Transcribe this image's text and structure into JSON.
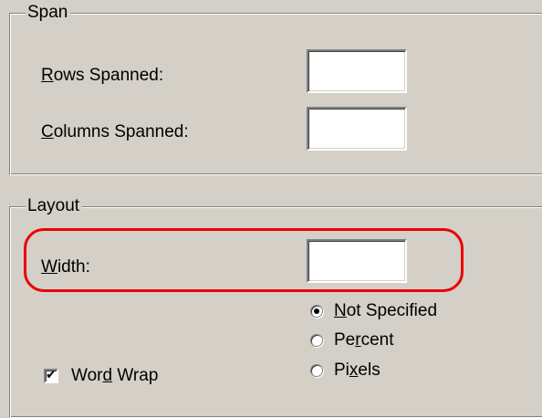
{
  "span": {
    "title": "Span",
    "rows_label_mnemonic": "R",
    "rows_label_rest": "ows Spanned:",
    "rows_value": "",
    "cols_label_mnemonic": "C",
    "cols_label_rest": "olumns Spanned:",
    "cols_value": ""
  },
  "layout": {
    "title": "Layout",
    "width_label_mnemonic": "W",
    "width_label_rest": "idth:",
    "width_value": "",
    "width_units": {
      "not_specified_mnemonic": "N",
      "not_specified_rest": "ot Specified",
      "not_specified_checked": true,
      "percent_pre": "Pe",
      "percent_mnemonic": "r",
      "percent_post": "cent",
      "pixels_pre": "Pi",
      "pixels_mnemonic": "x",
      "pixels_post": "els"
    },
    "word_wrap_pre": "Wor",
    "word_wrap_mnemonic": "d",
    "word_wrap_post": " Wrap",
    "word_wrap_checked": true,
    "checkmark_glyph": "✔"
  },
  "colors": {
    "dialog_bg": "#d4d0c8",
    "highlight": "#ee0000"
  }
}
